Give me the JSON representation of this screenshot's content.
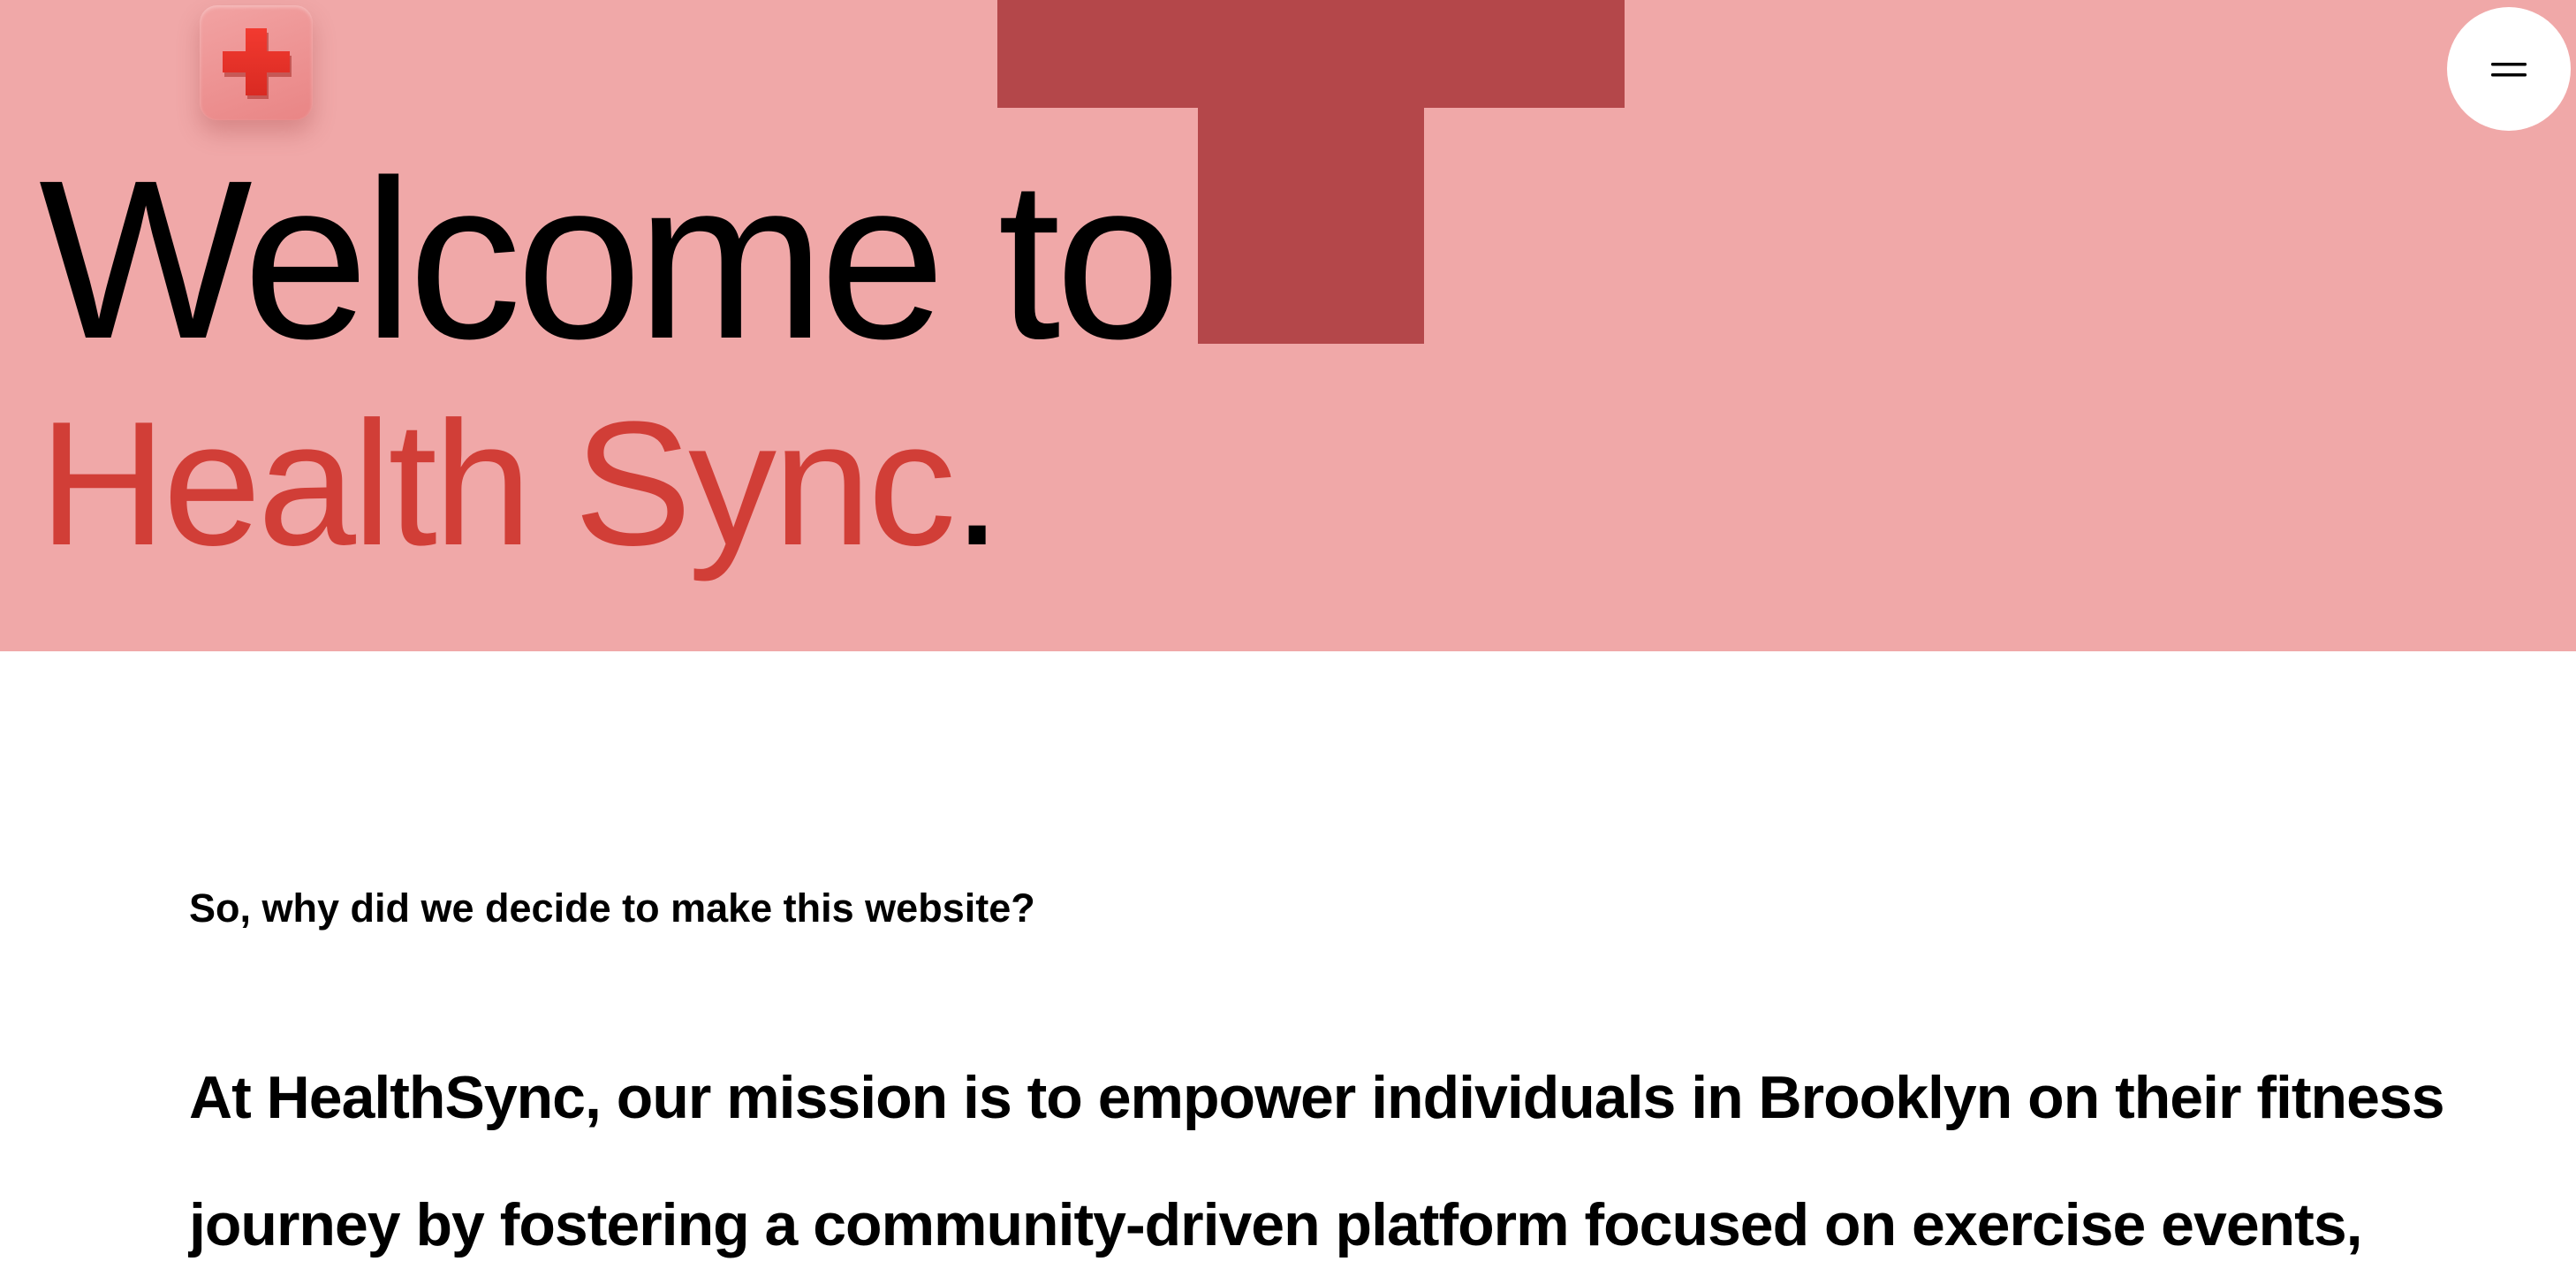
{
  "colors": {
    "hero_background": "#f0a8a8",
    "cross_dark": "#b4474a",
    "brand_red": "#d13e37",
    "logo_cross_red": "#e8332d",
    "text": "#000000",
    "page_background": "#ffffff"
  },
  "header": {
    "logo_icon": "red-cross-icon",
    "menu_icon": "menu-icon"
  },
  "hero": {
    "title": "Welcome to",
    "brand_name": "Health Sync",
    "brand_period": "."
  },
  "about": {
    "question": "So, why did we decide to make this website?",
    "mission_lines": [
      "At HealthSync, our mission is to empower individuals in Brooklyn on their fitness",
      "journey by fostering a community-driven platform focused on exercise events,"
    ]
  }
}
